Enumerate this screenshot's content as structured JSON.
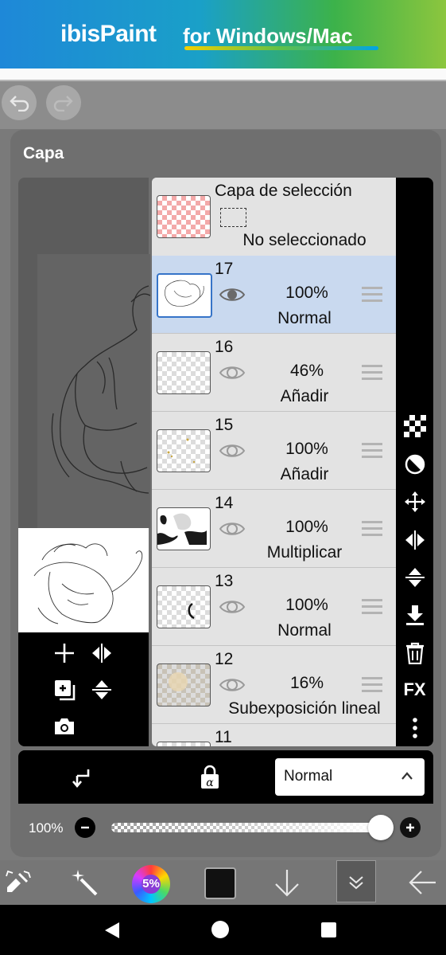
{
  "banner": {
    "brand": "ibisPaint",
    "tagline": "for Windows/Mac"
  },
  "panel": {
    "title": "Capa"
  },
  "selection_layer": {
    "title": "Capa de selección",
    "status": "No seleccionado"
  },
  "layers": [
    {
      "number": "17",
      "opacity": "100%",
      "blend": "Normal",
      "selected": true
    },
    {
      "number": "16",
      "opacity": "46%",
      "blend": "Añadir",
      "selected": false
    },
    {
      "number": "15",
      "opacity": "100%",
      "blend": "Añadir",
      "selected": false
    },
    {
      "number": "14",
      "opacity": "100%",
      "blend": "Multiplicar",
      "selected": false
    },
    {
      "number": "13",
      "opacity": "100%",
      "blend": "Normal",
      "selected": false
    },
    {
      "number": "12",
      "opacity": "16%",
      "blend": "Subexposición lineal",
      "selected": false
    },
    {
      "number": "11"
    }
  ],
  "right_toolbar": {
    "fx_label": "FX"
  },
  "blend_mode": {
    "value": "Normal"
  },
  "opacity": {
    "label": "100%",
    "value": 1.0
  },
  "bottom_toolbar": {
    "color_wheel_label": "5%"
  },
  "colors": {
    "selected_layer": "#c9d9ef",
    "selected_border": "#3674c8",
    "panel": "#6f6f6f",
    "current_color": "#111111"
  }
}
